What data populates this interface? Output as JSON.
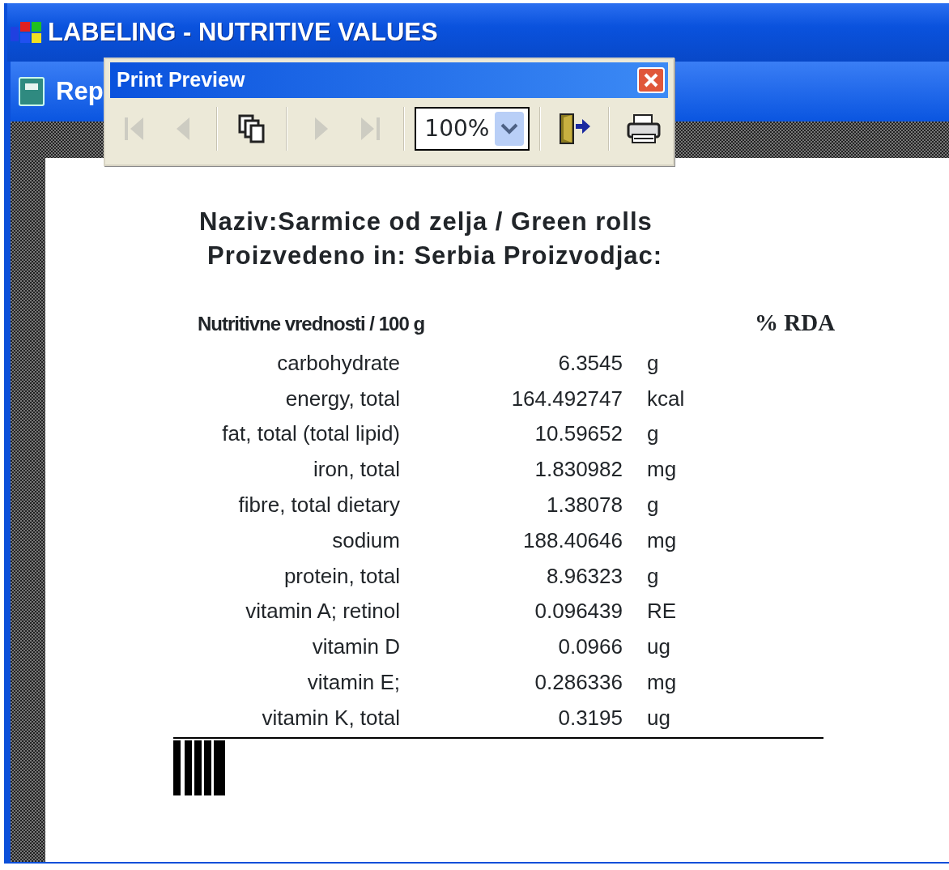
{
  "app_window": {
    "title": "LABELING - NUTRITIVE VALUES"
  },
  "report_window": {
    "title": "Rep"
  },
  "print_preview": {
    "title": "Print Preview",
    "toolbar": [
      {
        "kind": "first",
        "disabled": true
      },
      {
        "kind": "prev",
        "disabled": true
      },
      {
        "kind": "pages",
        "disabled": false
      },
      {
        "kind": "next",
        "disabled": true
      },
      {
        "kind": "last",
        "disabled": true
      },
      {
        "kind": "zoom",
        "value": "100%"
      },
      {
        "kind": "exit",
        "disabled": false
      },
      {
        "kind": "print",
        "disabled": false
      }
    ]
  },
  "label": {
    "name_line": "Naziv:Sarmice od zelja / Green rolls",
    "origin_line": "Proizvedeno in: Serbia Proizvodjac:",
    "table_heading": "Nutritivne vrednosti / 100 g",
    "rda_heading": "% RDA",
    "rows": [
      {
        "nutrient": "carbohydrate",
        "value": "6.3545",
        "unit": "g"
      },
      {
        "nutrient": "energy, total",
        "value": "164.492747",
        "unit": "kcal"
      },
      {
        "nutrient": "fat, total (total lipid)",
        "value": "10.59652",
        "unit": "g"
      },
      {
        "nutrient": "iron, total",
        "value": "1.830982",
        "unit": "mg"
      },
      {
        "nutrient": "fibre, total dietary",
        "value": "1.38078",
        "unit": "g"
      },
      {
        "nutrient": "sodium",
        "value": "188.40646",
        "unit": "mg"
      },
      {
        "nutrient": "protein, total",
        "value": "8.96323",
        "unit": "g"
      },
      {
        "nutrient": "vitamin A; retinol",
        "value": "0.096439",
        "unit": "RE"
      },
      {
        "nutrient": "vitamin D",
        "value": "0.0966",
        "unit": "ug"
      },
      {
        "nutrient": "vitamin E;",
        "value": "0.286336",
        "unit": "mg"
      },
      {
        "nutrient": "vitamin K, total",
        "value": "0.3195",
        "unit": "ug"
      }
    ]
  }
}
